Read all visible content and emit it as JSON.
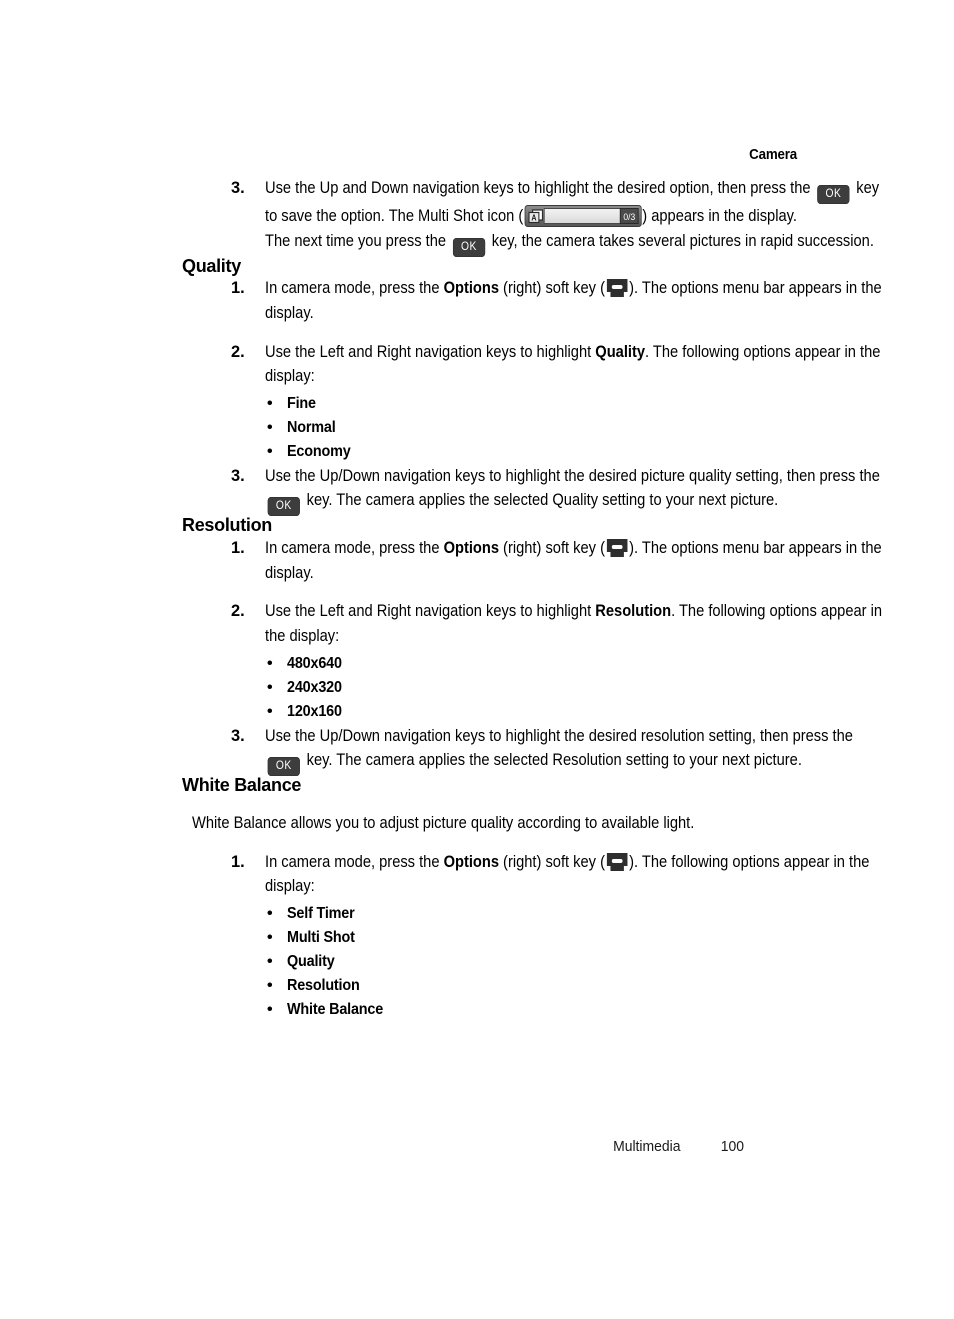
{
  "header": {
    "chapter_title": "Camera"
  },
  "footer": {
    "section": "Multimedia",
    "page_number": "100"
  },
  "icons": {
    "ok_key_label": "OK",
    "soft_key_name": "right-soft-key",
    "multishot_counter": "0/3"
  },
  "colors": {
    "key_fill": "#3d3d3d",
    "text": "#000000",
    "page_background": "#ffffff"
  },
  "content": {
    "multi_shot_step": {
      "number": "3.",
      "text_part1": "Use the Up and Down navigation keys to highlight the desired option, then press the ",
      "text_part2": " key to save the option. The Multi Shot icon (",
      "text_part3": ") appears in the display.",
      "text_part4": "The next time you press the ",
      "text_part5": " key, the camera takes several pictures in rapid succession."
    },
    "sections": [
      {
        "heading": "Quality",
        "steps": [
          {
            "number": "1.",
            "pre": "In camera mode, press the ",
            "bold": "Options",
            "mid": " (right) soft key (",
            "post": "). The options menu bar appears in the display."
          },
          {
            "number": "2.",
            "pre": "Use the Left and Right navigation keys to highlight ",
            "bold": "Quality",
            "post": ". The following options appear in the display:"
          },
          {
            "number": "3.",
            "pre": "Use the Up/Down navigation keys to highlight the desired picture quality setting, then press the ",
            "post": " key. The camera applies the selected Quality setting to your next picture."
          }
        ],
        "bullets": [
          "Fine",
          "Normal",
          "Economy"
        ]
      },
      {
        "heading": "Resolution",
        "steps": [
          {
            "number": "1.",
            "pre": "In camera mode, press the ",
            "bold": "Options",
            "mid": " (right) soft key (",
            "post": "). The options menu bar appears in the display."
          },
          {
            "number": "2.",
            "pre": "Use the Left and Right navigation keys to highlight ",
            "bold": "Resolution",
            "post": ". The following options appear in the display:"
          },
          {
            "number": "3.",
            "pre": "Use the Up/Down navigation keys to highlight the desired resolution setting, then press the ",
            "post": " key. The camera applies the selected Resolution setting to your next picture."
          }
        ],
        "bullets": [
          "480x640",
          "240x320",
          "120x160"
        ]
      },
      {
        "heading": "White Balance",
        "intro": "White Balance allows you to adjust picture quality according to available light.",
        "steps": [
          {
            "number": "1.",
            "pre": "In camera mode, press the ",
            "bold": "Options",
            "mid": " (right) soft key (",
            "post": "). The following options appear in the display:"
          }
        ],
        "bullets": [
          "Self Timer",
          "Multi Shot",
          "Quality",
          "Resolution",
          "White Balance"
        ]
      }
    ]
  }
}
